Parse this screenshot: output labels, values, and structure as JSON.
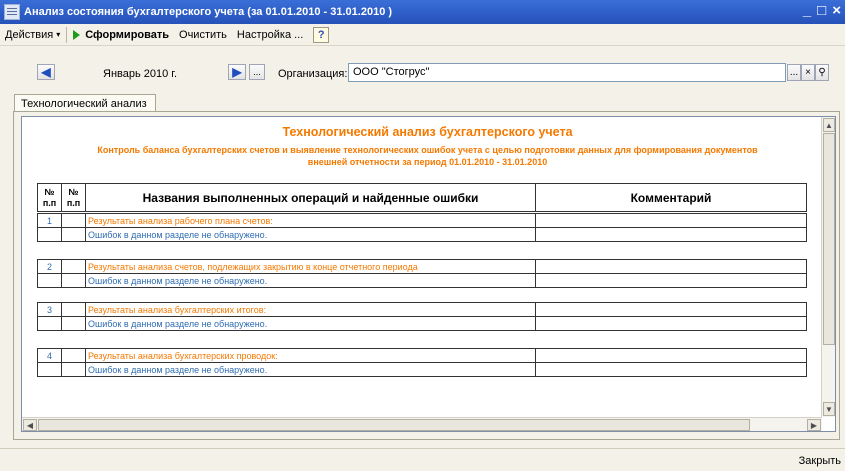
{
  "window": {
    "title": "Анализ состояния бухгалтерского учета (за 01.01.2010  - 31.01.2010 )",
    "min_symbol": "_",
    "restore_symbol": "□",
    "close_symbol": "×"
  },
  "toolbar": {
    "actions_label": "Действия",
    "run_label": "Сформировать",
    "clear_label": "Очистить",
    "settings_label": "Настройка ...",
    "help_label": "?"
  },
  "period": {
    "label": "Январь 2010 г.",
    "dots": "...",
    "org_label": "Организация:",
    "org_value": "ООО \"Стогрус\"",
    "org_dots": "...",
    "org_clear": "×",
    "org_search": "⚲"
  },
  "tabs": [
    "Технологический анализ"
  ],
  "report": {
    "title": "Технологический анализ бухгалтерского учета",
    "subtitle_line1": "Контроль баланса бухгалтерских счетов и выявление технологических ошибок учета с целью подготовки данных для формирования документов",
    "subtitle_line2": "внешней отчетности за период 01.01.2010  - 31.01.2010",
    "columns": {
      "num1": "№ п.п",
      "num2": "№ п.п",
      "operations": "Названия выполненных операций и найденные ошибки",
      "comment": "Комментарий"
    },
    "blocks": [
      {
        "num": "1",
        "heading": "Результаты анализа рабочего плана счетов:",
        "result": "Ошибок в данном разделе не обнаружено."
      },
      {
        "num": "2",
        "heading": "Результаты анализа счетов, подлежащих закрытию в конце отчетного периода",
        "result": "Ошибок в данном разделе не обнаружено."
      },
      {
        "num": "3",
        "heading": "Результаты анализа бухгалтерских итогов:",
        "result": "Ошибок в данном разделе не обнаружено."
      },
      {
        "num": "4",
        "heading": "Результаты анализа бухгалтерских проводок:",
        "result": "Ошибок в данном разделе не обнаружено."
      }
    ]
  },
  "statusbar": {
    "close_label": "Закрыть"
  },
  "colors": {
    "accent_orange": "#f57900",
    "link_blue": "#2f6db3",
    "titlebar_blue": "#2f5fc9"
  }
}
